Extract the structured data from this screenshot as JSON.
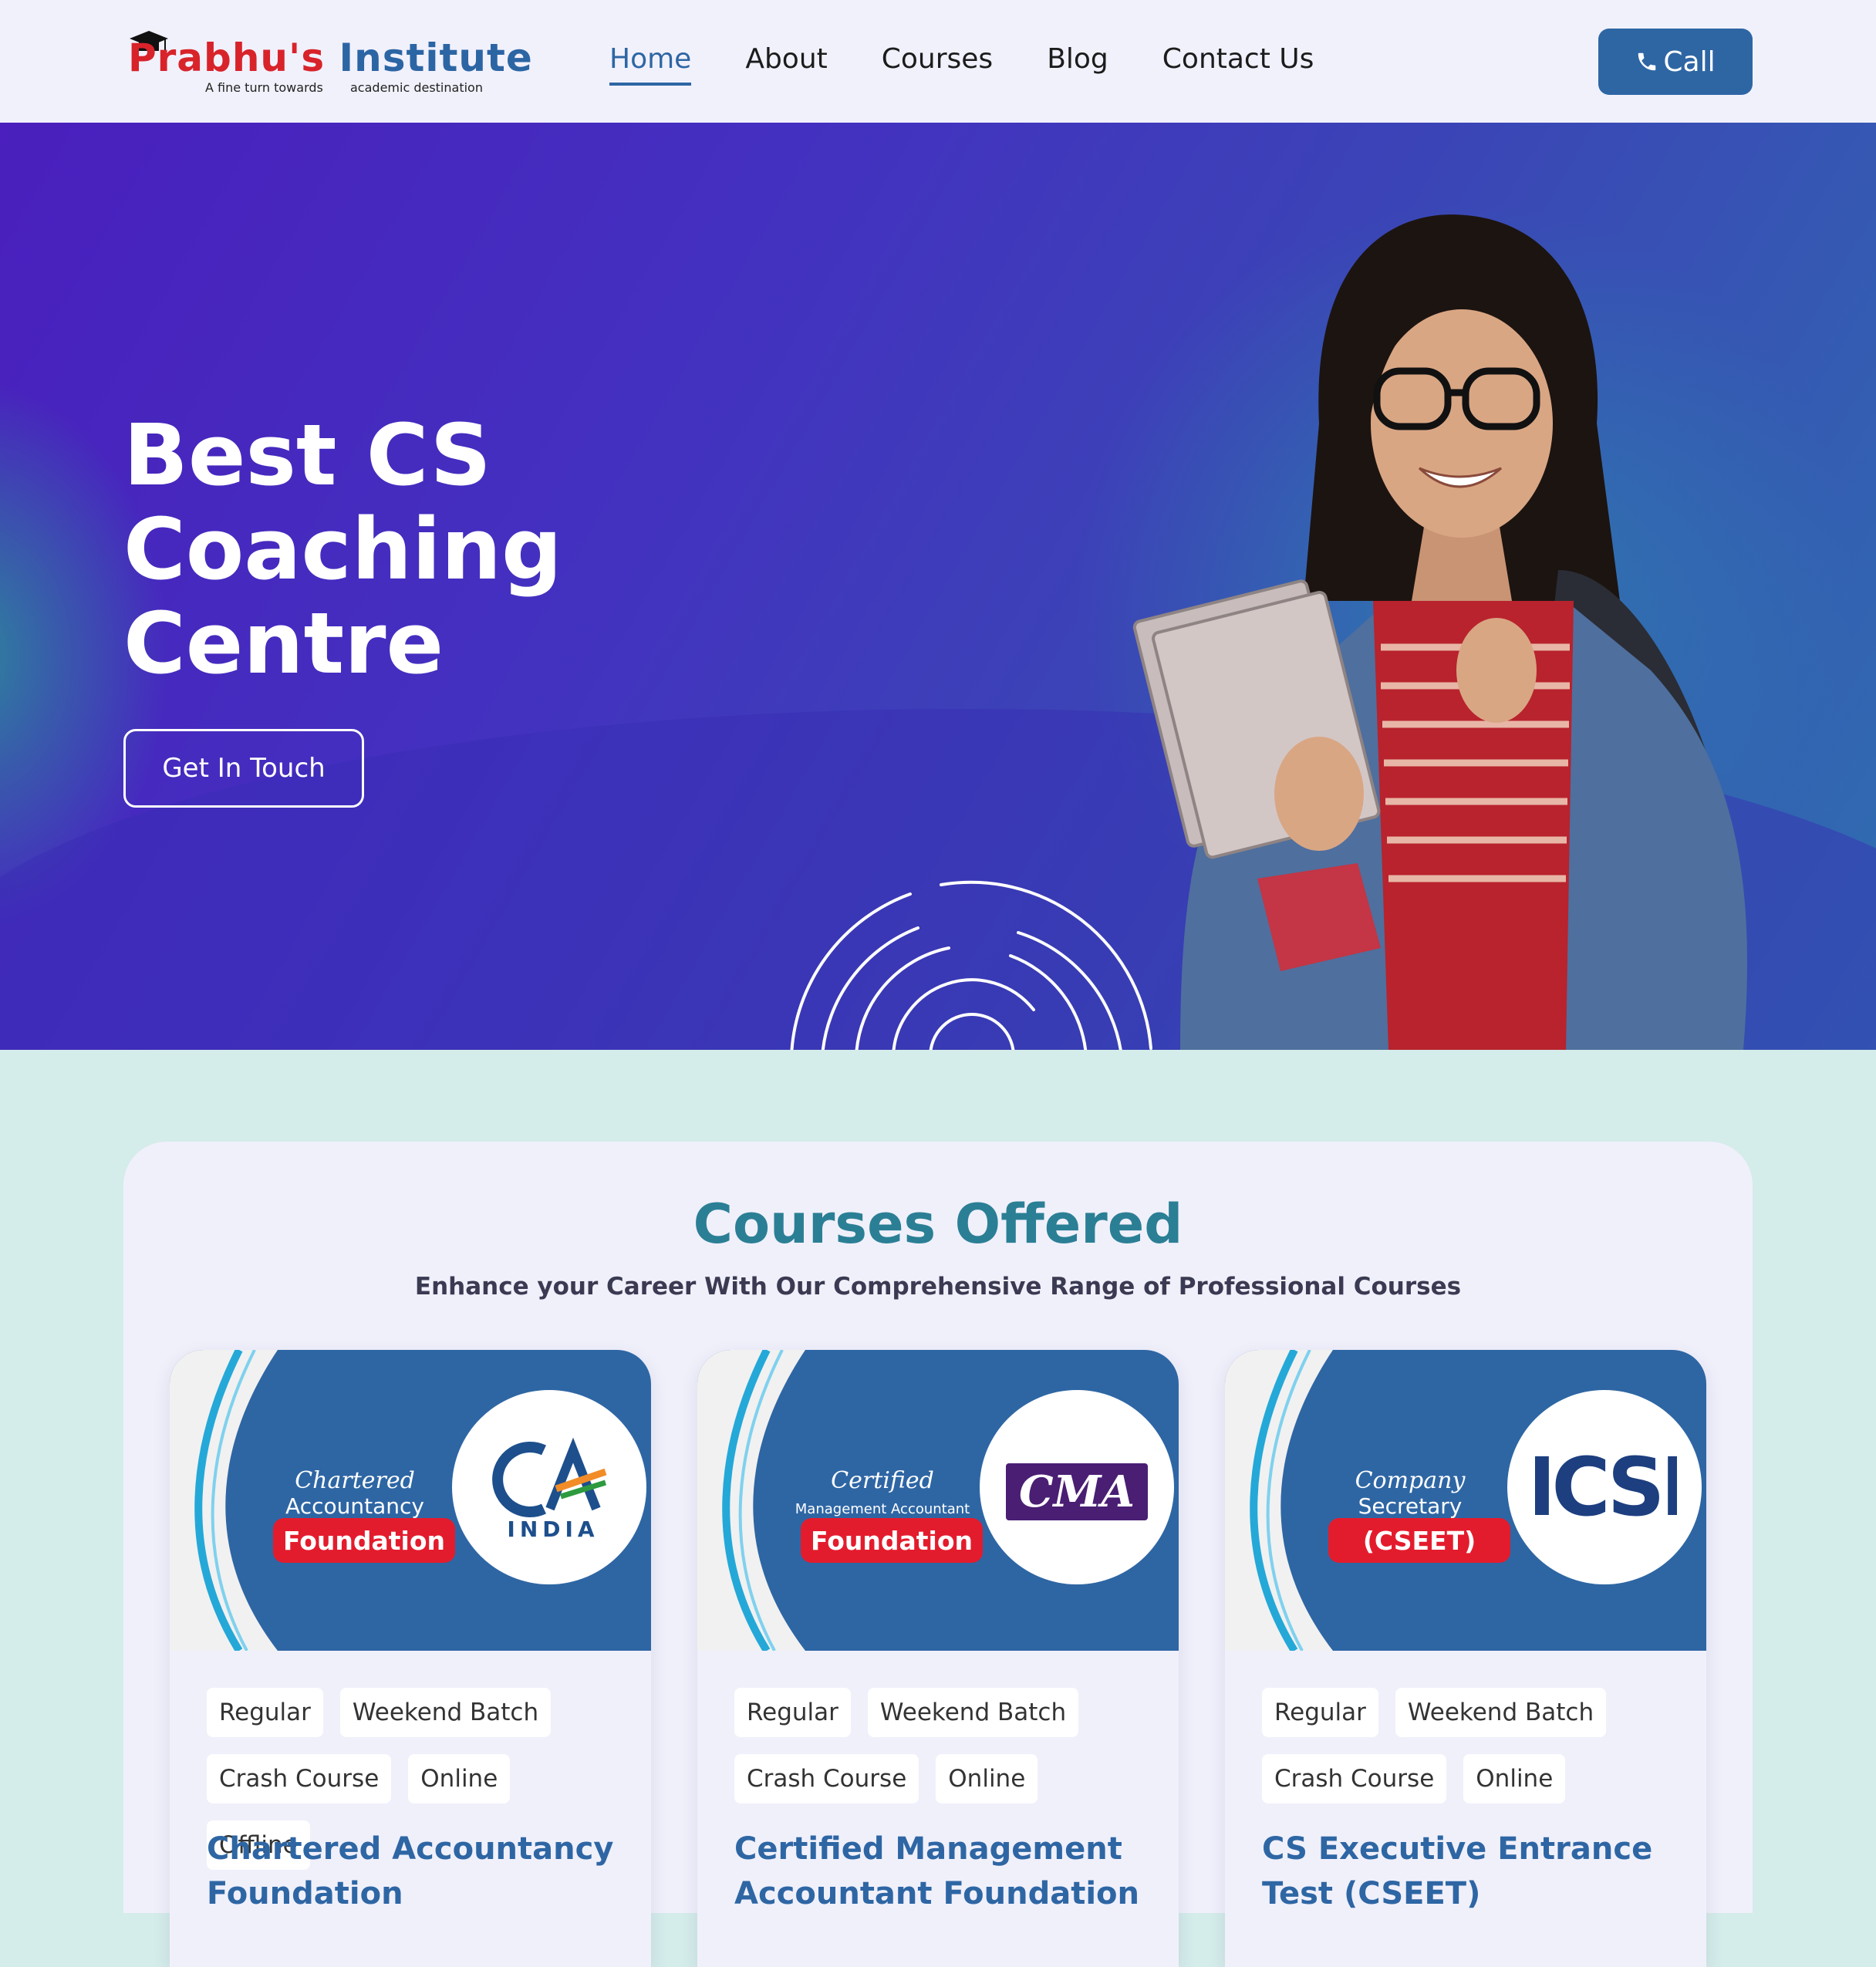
{
  "brand": {
    "name_part1": "Prabhu's",
    "name_part2": "Institute",
    "tagline_left": "A fine turn towards",
    "tagline_right": "academic destination"
  },
  "nav": {
    "items": [
      {
        "label": "Home",
        "active": true
      },
      {
        "label": "About",
        "active": false
      },
      {
        "label": "Courses",
        "active": false
      },
      {
        "label": "Blog",
        "active": false
      },
      {
        "label": "Contact Us",
        "active": false
      }
    ],
    "call_label": "Call",
    "call_icon": "phone-icon"
  },
  "hero": {
    "title_line1": "Best CS",
    "title_line2": "Coaching",
    "title_line3": "Centre",
    "cta_label": "Get In Touch"
  },
  "courses": {
    "title": "Courses Offered",
    "subtitle": "Enhance your Career With Our Comprehensive Range of Professional Courses",
    "cards": [
      {
        "banner_script": "Chartered",
        "banner_line": "Accountancy",
        "banner_pill": "Foundation",
        "logo_text": "INDIA",
        "tags": [
          "Regular",
          "Weekend Batch",
          "Crash Course",
          "Online",
          "Offline"
        ],
        "title": "Chartered Accountancy Foundation"
      },
      {
        "banner_script": "Certified",
        "banner_line": "Management Accountant",
        "banner_pill": "Foundation",
        "logo_text": "CMA",
        "tags": [
          "Regular",
          "Weekend Batch",
          "Crash Course",
          "Online"
        ],
        "title": "Certified Management Accountant Foundation"
      },
      {
        "banner_script": "Company",
        "banner_line": "Secretary",
        "banner_pill": "(CSEET)",
        "logo_text": "ICSI",
        "tags": [
          "Regular",
          "Weekend Batch",
          "Crash Course",
          "Online"
        ],
        "title": "CS Executive Entrance Test (CSEET)"
      }
    ]
  },
  "colors": {
    "primary_blue": "#2e66a4",
    "heading_teal": "#2b7f95",
    "brand_red": "#d8232a",
    "hero_purple": "#4a1fbd",
    "pill_red": "#e31c2d"
  }
}
